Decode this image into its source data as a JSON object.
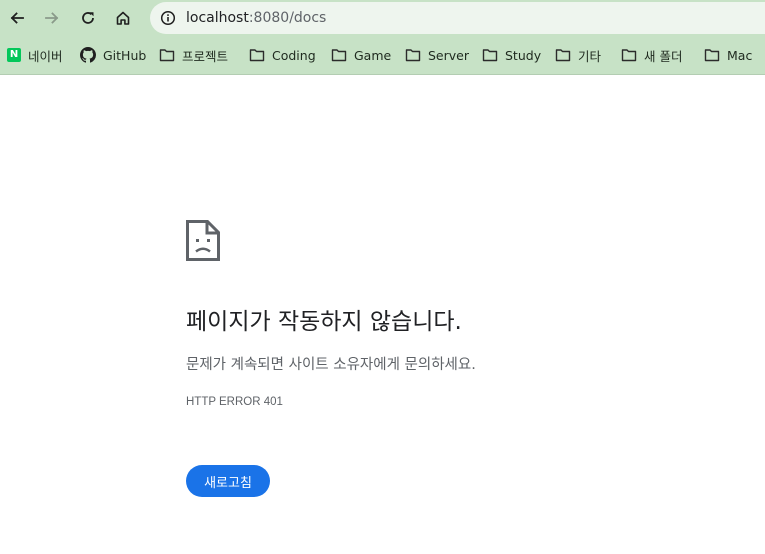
{
  "browser": {
    "url_host": "localhost",
    "url_path": ":8080/docs"
  },
  "bookmarks": [
    {
      "label": "네이버",
      "icon": "naver-icon"
    },
    {
      "label": "GitHub",
      "icon": "github-icon"
    },
    {
      "label": "프로젝트",
      "icon": "folder-icon"
    },
    {
      "label": "Coding",
      "icon": "folder-icon"
    },
    {
      "label": "Game",
      "icon": "folder-icon"
    },
    {
      "label": "Server",
      "icon": "folder-icon"
    },
    {
      "label": "Study",
      "icon": "folder-icon"
    },
    {
      "label": "기타",
      "icon": "folder-icon"
    },
    {
      "label": "새 폴더",
      "icon": "folder-icon"
    },
    {
      "label": "Mac",
      "icon": "folder-icon"
    }
  ],
  "naver_logo_letter": "N",
  "error": {
    "title": "페이지가 작동하지 않습니다.",
    "description": "문제가 계속되면 사이트 소유자에게 문의하세요.",
    "code": "HTTP ERROR 401",
    "reload_label": "새로고침"
  },
  "colors": {
    "toolbar_bg": "#c7e2c6",
    "accent": "#1a73e8"
  }
}
